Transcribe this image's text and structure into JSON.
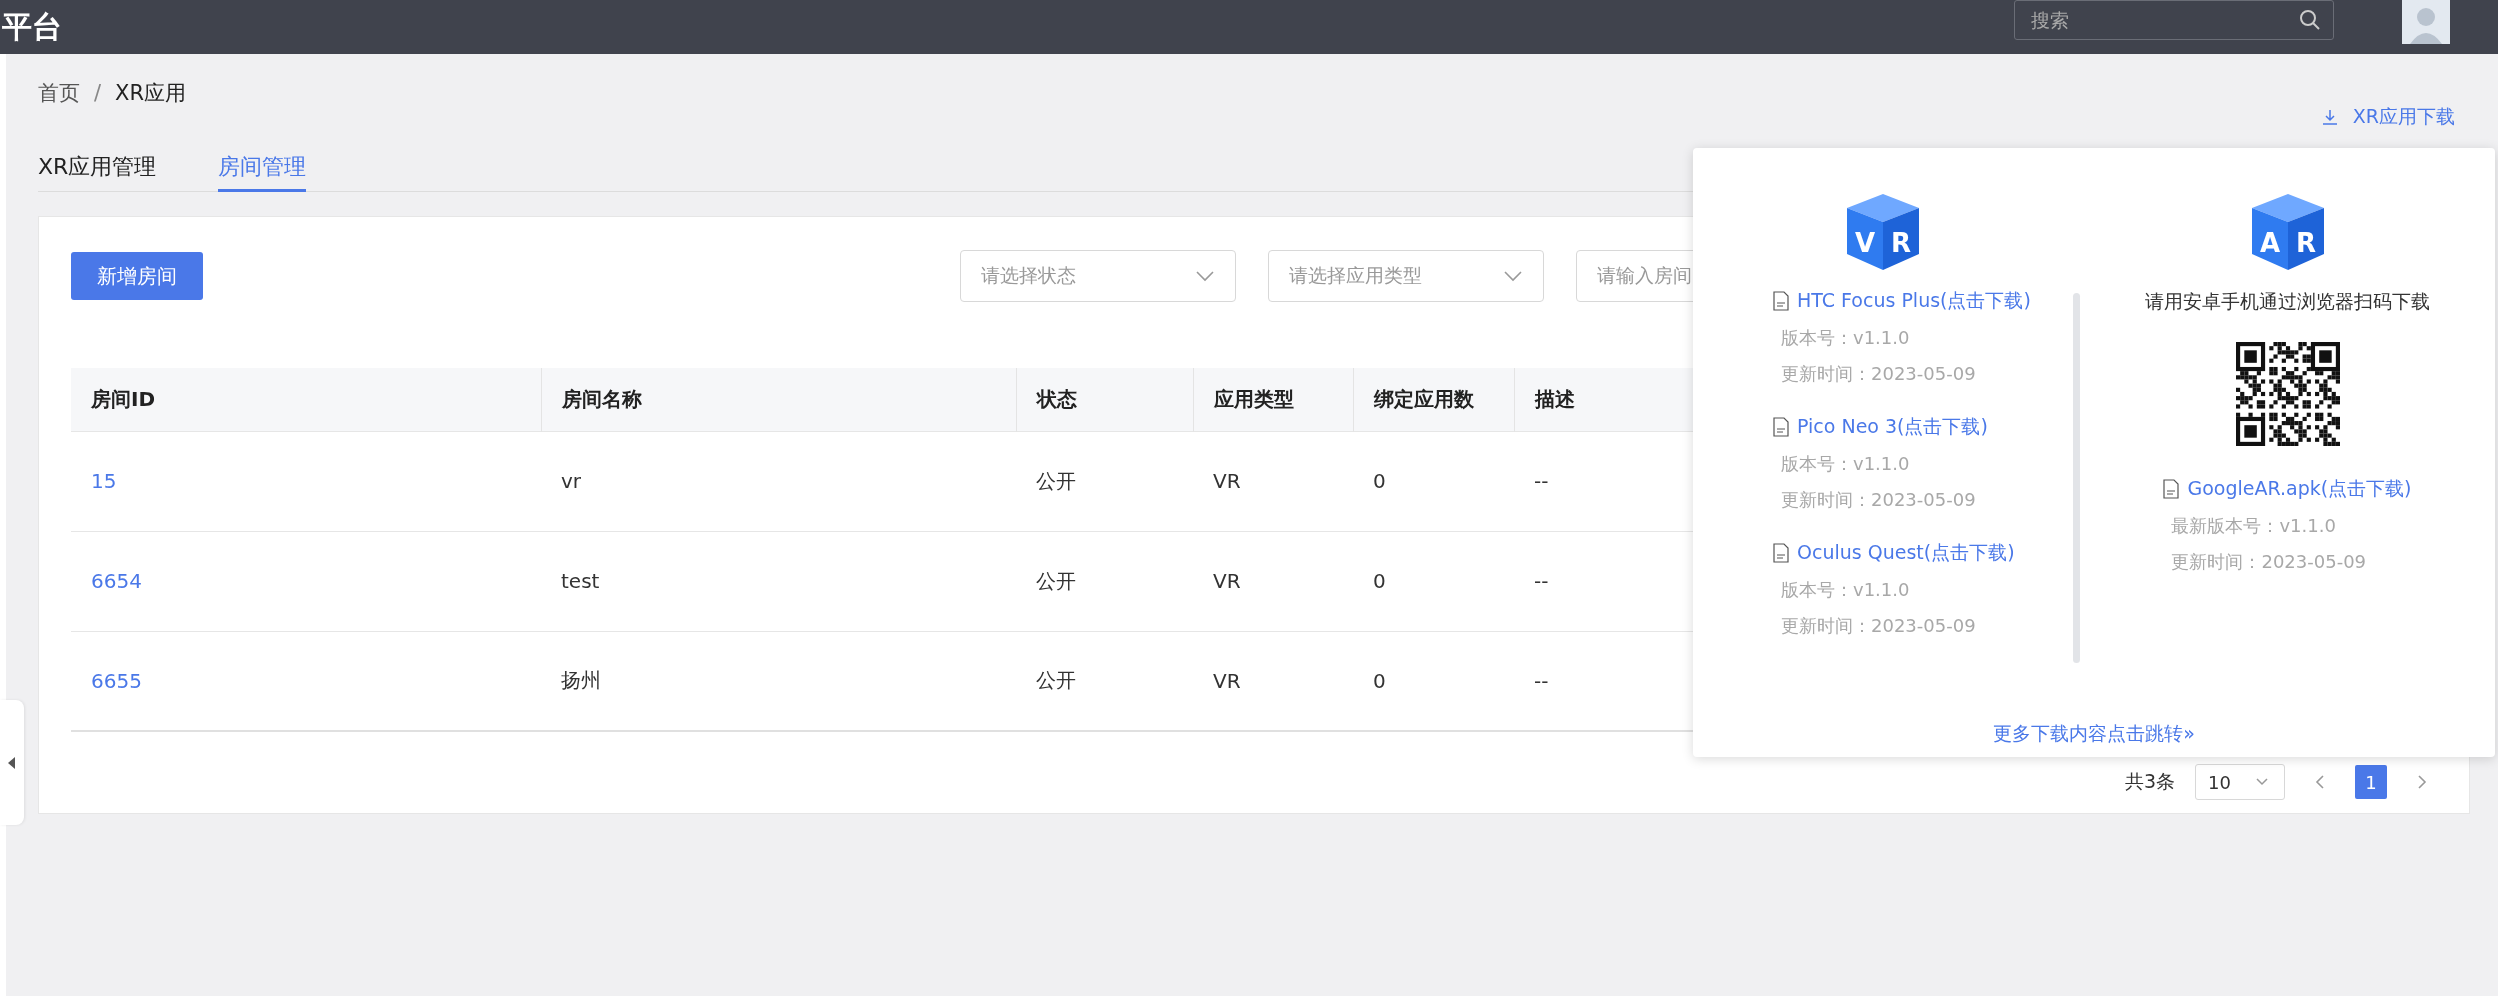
{
  "topbar": {
    "brand": "平台",
    "search": {
      "placeholder": "搜索"
    }
  },
  "breadcrumb": {
    "items": [
      "首页",
      "XR应用"
    ],
    "separator": "/"
  },
  "tabs": [
    {
      "label": "XR应用管理",
      "selected": false
    },
    {
      "label": "房间管理",
      "selected": true
    }
  ],
  "download_link": "XR应用下载",
  "toolbar": {
    "add_button": "新增房间",
    "filters": [
      {
        "kind": "select",
        "placeholder": "请选择状态"
      },
      {
        "kind": "select",
        "placeholder": "请选择应用类型"
      },
      {
        "kind": "input",
        "placeholder": "请输入房间"
      }
    ]
  },
  "table": {
    "columns": [
      "房间ID",
      "房间名称",
      "状态",
      "应用类型",
      "绑定应用数",
      "描述"
    ],
    "rows": [
      {
        "cells": [
          "15",
          "vr",
          "公开",
          "VR",
          "0",
          "--"
        ]
      },
      {
        "cells": [
          "6654",
          "test",
          "公开",
          "VR",
          "0",
          "--"
        ]
      },
      {
        "cells": [
          "6655",
          "扬州",
          "公开",
          "VR",
          "0",
          "--"
        ]
      }
    ]
  },
  "pagination": {
    "total": "共3条",
    "page_size": "10",
    "pages": [
      {
        "label": "1",
        "selected": true
      }
    ]
  },
  "download_popover": {
    "vr": {
      "cube_letters": [
        "V",
        "R"
      ],
      "apps": [
        {
          "name": "HTC Focus Plus(点击下载)",
          "version": "版本号：v1.1.0",
          "updated": "更新时间：2023-05-09"
        },
        {
          "name": "Pico Neo 3(点击下载)",
          "version": "版本号：v1.1.0",
          "updated": "更新时间：2023-05-09"
        },
        {
          "name": "Oculus Quest(点击下载)",
          "version": "版本号：v1.1.0",
          "updated": "更新时间：2023-05-09"
        }
      ]
    },
    "ar": {
      "cube_letters": [
        "A",
        "R"
      ],
      "instruction": "请用安卓手机通过浏览器扫码下载",
      "app": {
        "name": "GoogleAR.apk(点击下载)",
        "version": "最新版本号：v1.1.0",
        "updated": "更新时间：2023-05-09"
      }
    },
    "more_link": "更多下载内容点击跳转»"
  }
}
